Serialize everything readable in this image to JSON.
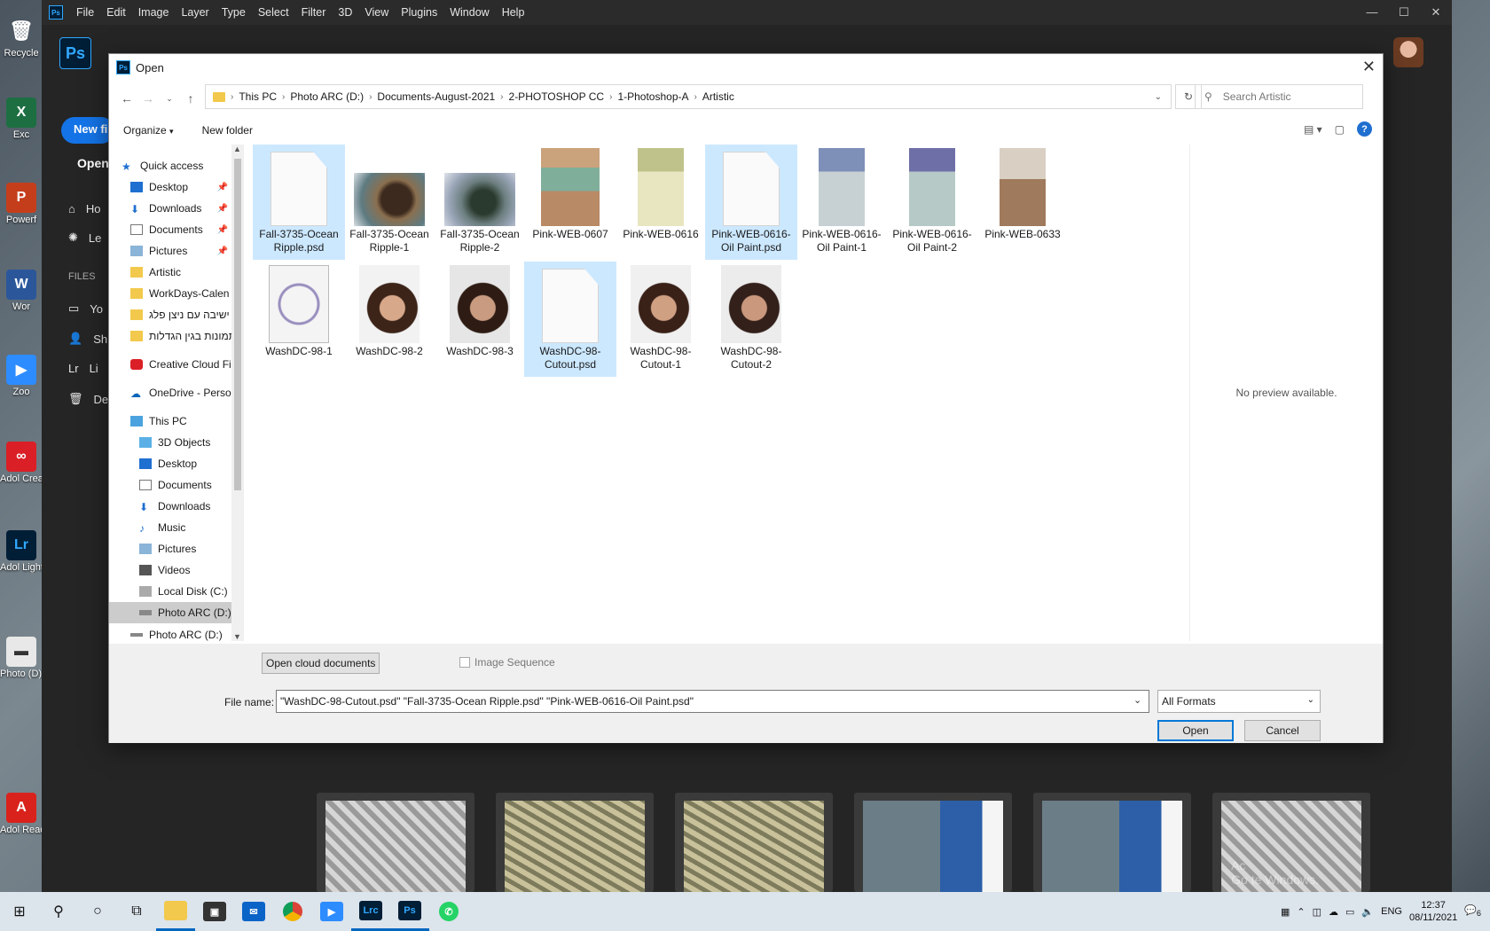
{
  "desktop": {
    "icons": [
      "Recycle",
      "Exc",
      "Powerf",
      "Wor",
      "Zoo",
      "Adol Creat",
      "Adol Lightro",
      "Photo (D) - Sho",
      "Adol Reade"
    ]
  },
  "photoshop": {
    "menu": [
      "File",
      "Edit",
      "Image",
      "Layer",
      "Type",
      "Select",
      "Filter",
      "3D",
      "View",
      "Plugins",
      "Window",
      "Help"
    ],
    "logo": "Ps",
    "new_file": "New fi",
    "open": "Open",
    "nav_home": "Ho",
    "nav_learn": "Le",
    "files_header": "FILES",
    "nav_your": "Yo",
    "nav_shared": "Sh",
    "nav_lightroom": "Li",
    "nav_deleted": "De",
    "watermark_1": "Ac",
    "watermark_2": "Go te Windows."
  },
  "dialog": {
    "title": "Open",
    "breadcrumbs": [
      "This PC",
      "Photo ARC (D:)",
      "Documents-August-2021",
      "2-PHOTOSHOP CC",
      "1-Photoshop-A",
      "Artistic"
    ],
    "search_placeholder": "Search Artistic",
    "organize": "Organize",
    "new_folder": "New folder",
    "nav_pane": {
      "quick_access": "Quick access",
      "quick_items": [
        "Desktop",
        "Downloads",
        "Documents",
        "Pictures",
        "Artistic",
        "WorkDays-Calen",
        "ישיבה עם ניצן פלג",
        "תמונות בגין הגדלות"
      ],
      "creative_cloud": "Creative Cloud Fil",
      "onedrive": "OneDrive - Person",
      "this_pc": "This PC",
      "pc_items": [
        "3D Objects",
        "Desktop",
        "Documents",
        "Downloads",
        "Music",
        "Pictures",
        "Videos",
        "Local Disk (C:)",
        "Photo ARC (D:)"
      ],
      "cut_off_item": "Photo ARC (D:)"
    },
    "files": [
      {
        "name": "Fall-3735-Ocean Ripple.psd",
        "selected": true,
        "kind": "blank"
      },
      {
        "name": "Fall-3735-Ocean Ripple-1",
        "selected": false,
        "kind": "rocks"
      },
      {
        "name": "Fall-3735-Ocean Ripple-2",
        "selected": false,
        "kind": "rocks"
      },
      {
        "name": "Pink-WEB-0607",
        "selected": false,
        "kind": "cabinet-green"
      },
      {
        "name": "Pink-WEB-0616",
        "selected": false,
        "kind": "cabinet-cream"
      },
      {
        "name": "Pink-WEB-0616-Oil Paint.psd",
        "selected": true,
        "kind": "blank"
      },
      {
        "name": "Pink-WEB-0616-Oil Paint-1",
        "selected": false,
        "kind": "cabinet-blue"
      },
      {
        "name": "Pink-WEB-0616-Oil Paint-2",
        "selected": false,
        "kind": "cabinet-blue"
      },
      {
        "name": "Pink-WEB-0633",
        "selected": false,
        "kind": "shelf"
      },
      {
        "name": "WashDC-98-1",
        "selected": false,
        "kind": "sketch"
      },
      {
        "name": "WashDC-98-2",
        "selected": false,
        "kind": "portrait"
      },
      {
        "name": "WashDC-98-3",
        "selected": false,
        "kind": "portrait"
      },
      {
        "name": "WashDC-98-Cutout.psd",
        "selected": true,
        "kind": "blank"
      },
      {
        "name": "WashDC-98-Cutout-1",
        "selected": false,
        "kind": "portrait"
      },
      {
        "name": "WashDC-98-Cutout-2",
        "selected": false,
        "kind": "portrait"
      }
    ],
    "preview_text": "No preview available.",
    "open_cloud": "Open cloud documents",
    "image_sequence": "Image Sequence",
    "file_name_label": "File name:",
    "file_name_value": "\"WashDC-98-Cutout.psd\" \"Fall-3735-Ocean Ripple.psd\" \"Pink-WEB-0616-Oil Paint.psd\"",
    "format": "All Formats",
    "open_button": "Open",
    "cancel_button": "Cancel"
  },
  "taskbar": {
    "lang": "ENG",
    "time": "12:37",
    "date": "08/11/2021",
    "notifications": "6"
  }
}
